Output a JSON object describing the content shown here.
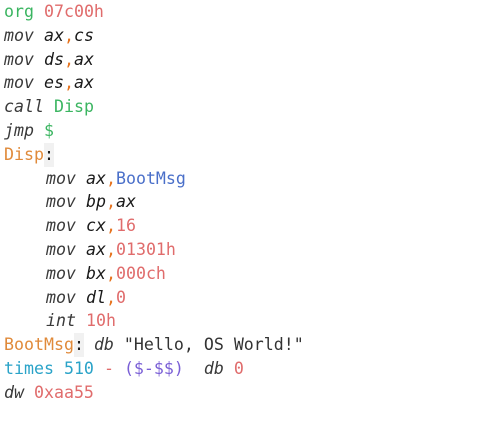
{
  "editor": {
    "lines": [
      {
        "id": "l1",
        "tokens": [
          {
            "text": "org",
            "cls": "kw-green",
            "name": "directive-org"
          },
          {
            "text": " ",
            "cls": "sp",
            "name": "space"
          },
          {
            "text": "07c00h",
            "cls": "num",
            "name": "number-literal"
          }
        ]
      },
      {
        "id": "l2",
        "tokens": [
          {
            "text": "mov",
            "cls": "ins",
            "name": "instruction"
          },
          {
            "text": " ",
            "cls": "sp",
            "name": "space"
          },
          {
            "text": "ax",
            "cls": "reg",
            "name": "register"
          },
          {
            "text": ",",
            "cls": "punc",
            "name": "comma"
          },
          {
            "text": "cs",
            "cls": "reg",
            "name": "register"
          }
        ]
      },
      {
        "id": "l3",
        "tokens": [
          {
            "text": "mov",
            "cls": "ins",
            "name": "instruction"
          },
          {
            "text": " ",
            "cls": "sp",
            "name": "space"
          },
          {
            "text": "ds",
            "cls": "reg",
            "name": "register"
          },
          {
            "text": ",",
            "cls": "punc",
            "name": "comma"
          },
          {
            "text": "ax",
            "cls": "reg",
            "name": "register"
          }
        ]
      },
      {
        "id": "l4",
        "tokens": [
          {
            "text": "mov",
            "cls": "ins",
            "name": "instruction"
          },
          {
            "text": " ",
            "cls": "sp",
            "name": "space"
          },
          {
            "text": "es",
            "cls": "reg",
            "name": "register"
          },
          {
            "text": ",",
            "cls": "punc",
            "name": "comma"
          },
          {
            "text": "ax",
            "cls": "reg",
            "name": "register"
          }
        ]
      },
      {
        "id": "l5",
        "tokens": [
          {
            "text": "call",
            "cls": "ins",
            "name": "instruction"
          },
          {
            "text": " ",
            "cls": "sp",
            "name": "space"
          },
          {
            "text": "Disp",
            "cls": "kw-green",
            "name": "label-reference"
          }
        ]
      },
      {
        "id": "l6",
        "tokens": [
          {
            "text": "jmp",
            "cls": "ins",
            "name": "instruction"
          },
          {
            "text": " ",
            "cls": "sp",
            "name": "space"
          },
          {
            "text": "$",
            "cls": "kw-green",
            "name": "current-address-symbol"
          }
        ]
      },
      {
        "id": "l7",
        "tokens": [
          {
            "text": "Disp",
            "cls": "label-orange",
            "name": "label-definition"
          },
          {
            "text": ":",
            "cls": "label-bg",
            "name": "colon"
          }
        ]
      },
      {
        "id": "l8",
        "indent": true,
        "tokens": [
          {
            "text": "mov",
            "cls": "ins",
            "name": "instruction"
          },
          {
            "text": " ",
            "cls": "sp",
            "name": "space"
          },
          {
            "text": "ax",
            "cls": "reg",
            "name": "register"
          },
          {
            "text": ",",
            "cls": "punc",
            "name": "comma"
          },
          {
            "text": "BootMsg",
            "cls": "ident-blue",
            "name": "identifier"
          }
        ]
      },
      {
        "id": "l9",
        "indent": true,
        "tokens": [
          {
            "text": "mov",
            "cls": "ins",
            "name": "instruction"
          },
          {
            "text": " ",
            "cls": "sp",
            "name": "space"
          },
          {
            "text": "bp",
            "cls": "reg",
            "name": "register"
          },
          {
            "text": ",",
            "cls": "punc",
            "name": "comma"
          },
          {
            "text": "ax",
            "cls": "reg",
            "name": "register"
          }
        ]
      },
      {
        "id": "l10",
        "indent": true,
        "tokens": [
          {
            "text": "mov",
            "cls": "ins",
            "name": "instruction"
          },
          {
            "text": " ",
            "cls": "sp",
            "name": "space"
          },
          {
            "text": "cx",
            "cls": "reg",
            "name": "register"
          },
          {
            "text": ",",
            "cls": "punc",
            "name": "comma"
          },
          {
            "text": "16",
            "cls": "num",
            "name": "number-literal"
          }
        ]
      },
      {
        "id": "l11",
        "indent": true,
        "tokens": [
          {
            "text": "mov",
            "cls": "ins",
            "name": "instruction"
          },
          {
            "text": " ",
            "cls": "sp",
            "name": "space"
          },
          {
            "text": "ax",
            "cls": "reg",
            "name": "register"
          },
          {
            "text": ",",
            "cls": "punc",
            "name": "comma"
          },
          {
            "text": "01301h",
            "cls": "num",
            "name": "number-literal"
          }
        ]
      },
      {
        "id": "l12",
        "indent": true,
        "tokens": [
          {
            "text": "mov",
            "cls": "ins",
            "name": "instruction"
          },
          {
            "text": " ",
            "cls": "sp",
            "name": "space"
          },
          {
            "text": "bx",
            "cls": "reg",
            "name": "register"
          },
          {
            "text": ",",
            "cls": "punc",
            "name": "comma"
          },
          {
            "text": "000ch",
            "cls": "num",
            "name": "number-literal"
          }
        ]
      },
      {
        "id": "l13",
        "indent": true,
        "tokens": [
          {
            "text": "mov",
            "cls": "ins",
            "name": "instruction"
          },
          {
            "text": " ",
            "cls": "sp",
            "name": "space"
          },
          {
            "text": "dl",
            "cls": "reg",
            "name": "register"
          },
          {
            "text": ",",
            "cls": "punc",
            "name": "comma"
          },
          {
            "text": "0",
            "cls": "num",
            "name": "number-literal"
          }
        ]
      },
      {
        "id": "l14",
        "indent": true,
        "tokens": [
          {
            "text": "int",
            "cls": "ins",
            "name": "instruction"
          },
          {
            "text": " ",
            "cls": "sp",
            "name": "space"
          },
          {
            "text": "10h",
            "cls": "num",
            "name": "number-literal"
          }
        ]
      },
      {
        "id": "l15",
        "tokens": [
          {
            "text": "BootMsg",
            "cls": "label-orange",
            "name": "label-definition"
          },
          {
            "text": ":",
            "cls": "label-bg",
            "name": "colon"
          },
          {
            "text": " ",
            "cls": "sp",
            "name": "space"
          },
          {
            "text": "db",
            "cls": "ins",
            "name": "directive-db"
          },
          {
            "text": " ",
            "cls": "sp",
            "name": "space"
          },
          {
            "text": "\"Hello, OS World!\"",
            "cls": "str",
            "name": "string-literal"
          }
        ]
      },
      {
        "id": "l16",
        "tokens": [
          {
            "text": "times",
            "cls": "kw-teal",
            "name": "directive-times"
          },
          {
            "text": " ",
            "cls": "sp",
            "name": "space"
          },
          {
            "text": "510",
            "cls": "kw-teal",
            "name": "number-literal"
          },
          {
            "text": " ",
            "cls": "sp",
            "name": "space"
          },
          {
            "text": "-",
            "cls": "num",
            "name": "operator"
          },
          {
            "text": " ",
            "cls": "sp",
            "name": "space"
          },
          {
            "text": "($-$$)",
            "cls": "op",
            "name": "expression"
          },
          {
            "text": "  ",
            "cls": "sp",
            "name": "space"
          },
          {
            "text": "db",
            "cls": "ins",
            "name": "directive-db"
          },
          {
            "text": " ",
            "cls": "sp",
            "name": "space"
          },
          {
            "text": "0",
            "cls": "num",
            "name": "number-literal"
          }
        ]
      },
      {
        "id": "l17",
        "tokens": [
          {
            "text": "dw",
            "cls": "ins",
            "name": "directive-dw"
          },
          {
            "text": " ",
            "cls": "sp",
            "name": "space"
          },
          {
            "text": "0xaa55",
            "cls": "num",
            "name": "number-literal"
          }
        ]
      }
    ]
  }
}
